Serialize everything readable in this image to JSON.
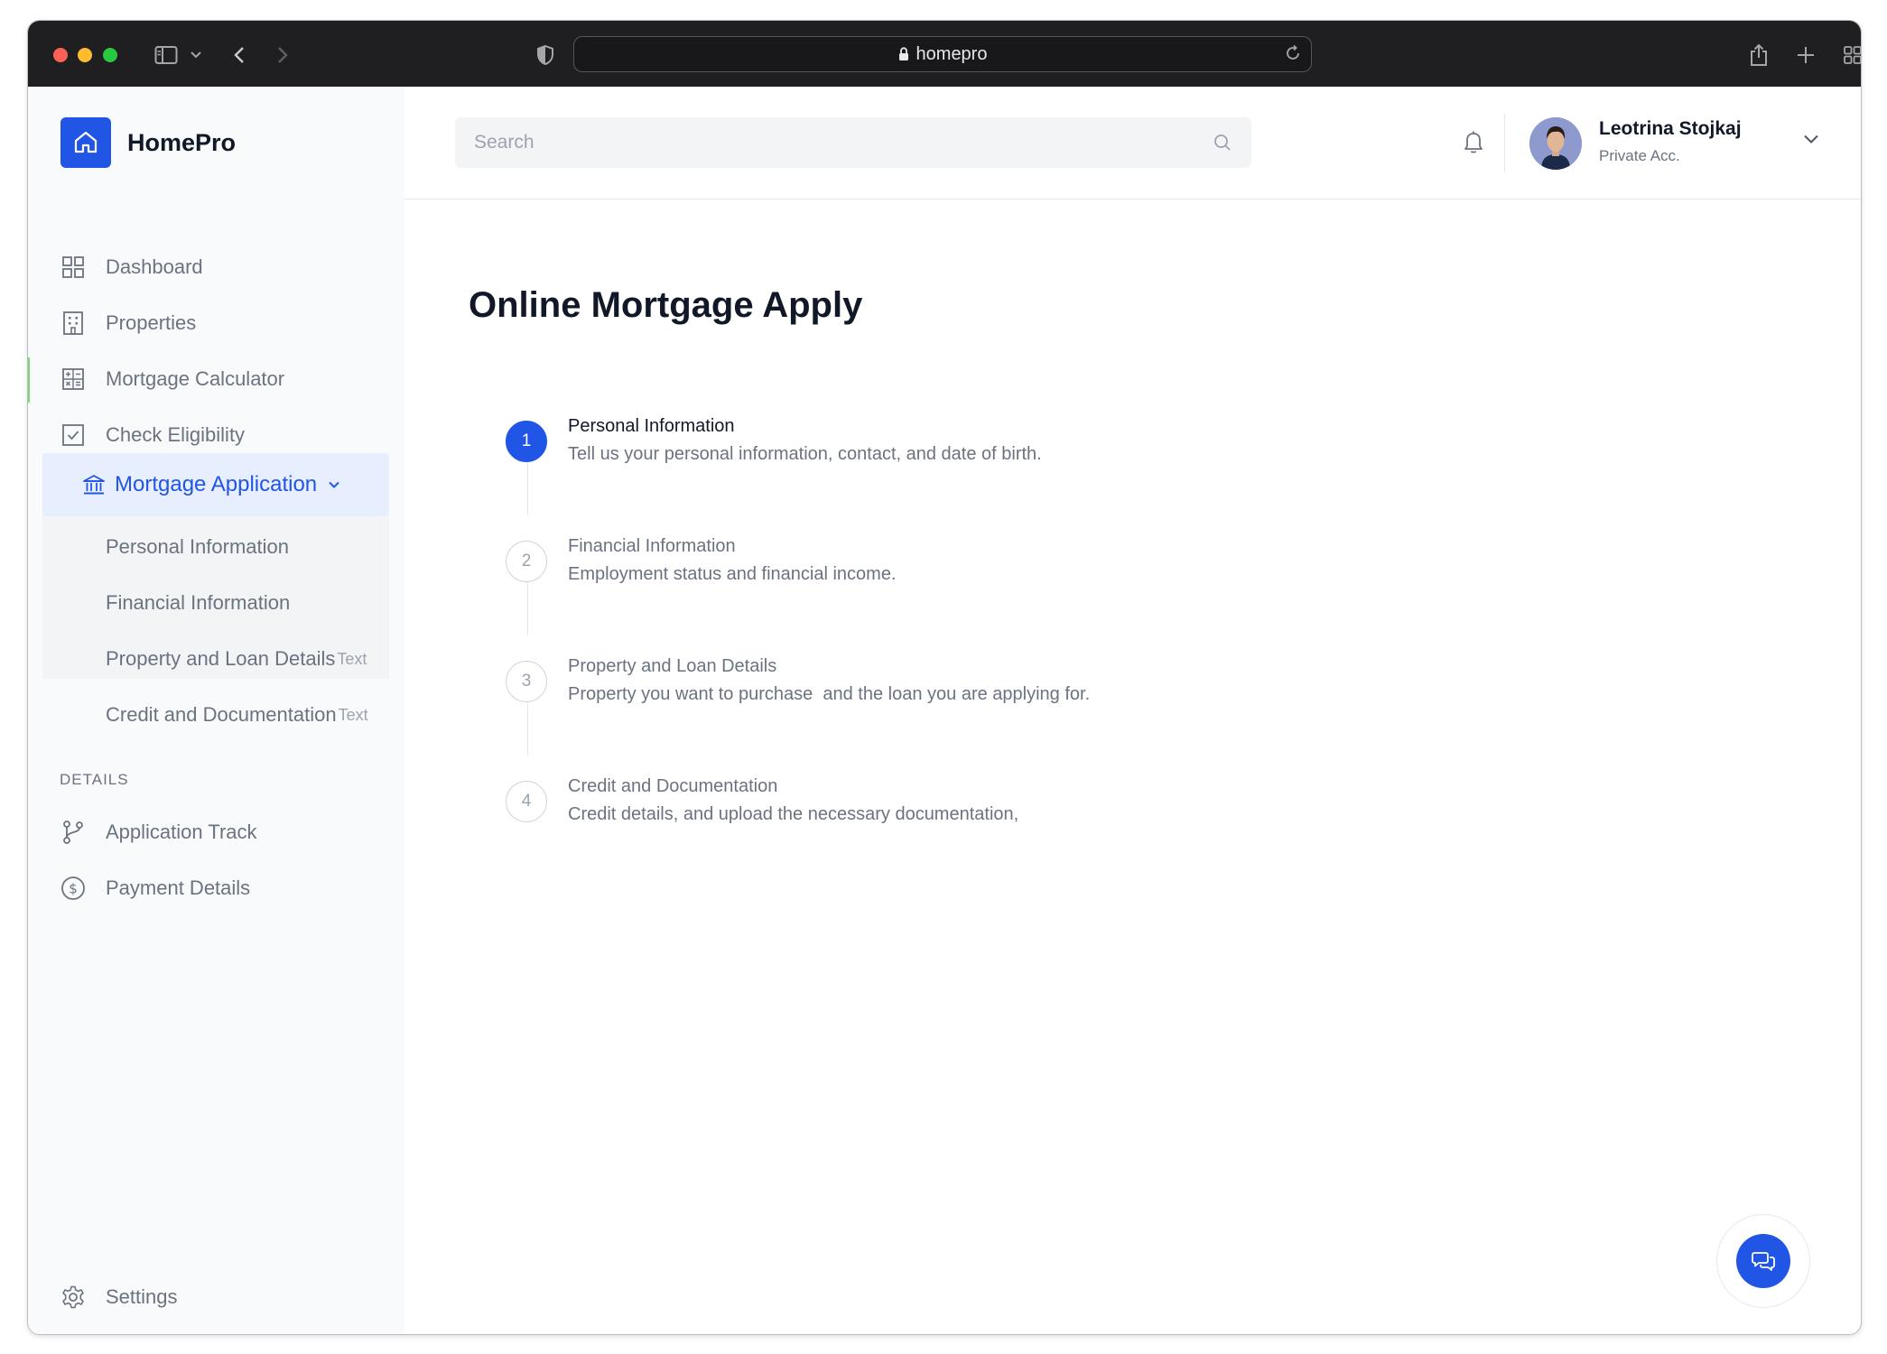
{
  "browser": {
    "url": "homepro"
  },
  "app": {
    "name": "HomePro"
  },
  "sidebar": {
    "nav": [
      {
        "label": "Dashboard",
        "icon": "grid-icon"
      },
      {
        "label": "Properties",
        "icon": "building-icon"
      },
      {
        "label": "Mortgage Calculator",
        "icon": "calculator-icon"
      },
      {
        "label": "Check Eligibility",
        "icon": "checkbox-icon"
      }
    ],
    "active": {
      "label": "Mortgage Application",
      "icon": "bank-icon"
    },
    "subitems": [
      {
        "label": "Personal Information",
        "tag": ""
      },
      {
        "label": "Financial Information",
        "tag": ""
      },
      {
        "label": "Property and Loan Details",
        "tag": "Text"
      },
      {
        "label": "Credit and Documentation",
        "tag": "Text"
      }
    ],
    "section_label": "DETAILS",
    "details": [
      {
        "label": "Application Track",
        "icon": "branch-icon"
      },
      {
        "label": "Payment Details",
        "icon": "dollar-circle-icon"
      }
    ],
    "settings": {
      "label": "Settings",
      "icon": "gear-icon"
    }
  },
  "header": {
    "search_placeholder": "Search",
    "user": {
      "name": "Leotrina Stojkaj",
      "account": "Private Acc."
    }
  },
  "main": {
    "title": "Online Mortgage Apply",
    "steps": [
      {
        "number": "1",
        "title": "Personal Information",
        "description": "Tell us your personal information, contact, and date of birth.",
        "active": true
      },
      {
        "number": "2",
        "title": "Financial Information",
        "description": "Employment status and financial income.",
        "active": false
      },
      {
        "number": "3",
        "title": "Property and Loan Details",
        "description": "Property you want to purchase  and the loan you are applying for.",
        "active": false
      },
      {
        "number": "4",
        "title": "Credit and Documentation",
        "description": "Credit details, and upload the necessary documentation,",
        "active": false
      }
    ]
  },
  "colors": {
    "accent": "#2155e6",
    "active_bg": "#e7efff",
    "titlebar": "#1f1f21"
  }
}
